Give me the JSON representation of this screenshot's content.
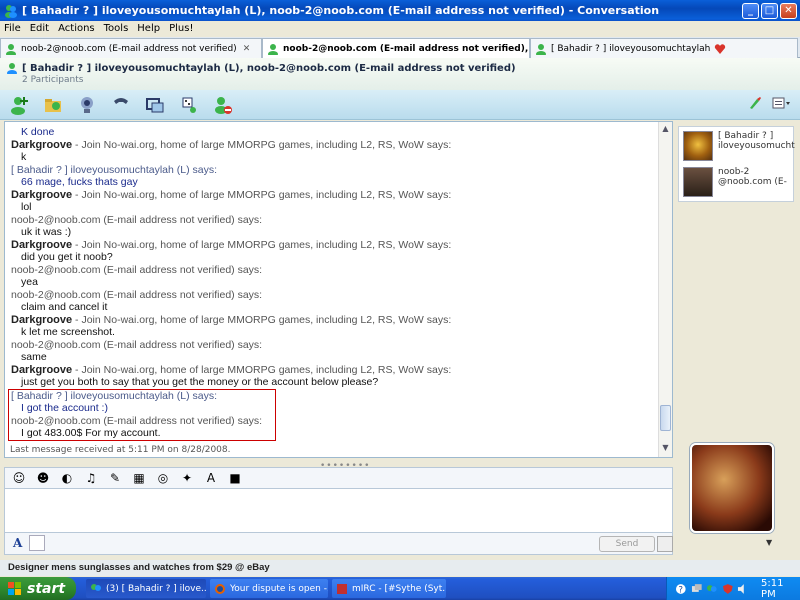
{
  "window": {
    "title": "[ Bahadir ? ] iloveyousomuchtaylah (L), noob-2@noob.com (E-mail address not verified) - Conversation",
    "buttons": [
      "_",
      "□",
      "✕"
    ]
  },
  "menu": [
    "File",
    "Edit",
    "Actions",
    "Tools",
    "Help",
    "Plus!"
  ],
  "tabs": [
    {
      "label": "noob-2@noob.com (E-mail address not verified)",
      "close": "✕",
      "active": false
    },
    {
      "label": "noob-2@noob.com (E-mail address not verified), [ ...",
      "close": "✕",
      "active": true
    },
    {
      "label": "[ Bahadir ? ] iloveyousomuchtaylah",
      "close": "",
      "active": false
    }
  ],
  "header": {
    "participants_line": "[ Bahadir ? ] iloveyousomuchtaylah (L), noob-2@noob.com (E-mail address not verified)",
    "count": "2 Participants"
  },
  "toolbar_icons": [
    "invite-icon",
    "share-files-icon",
    "video-call-icon",
    "phone-icon",
    "activities-icon",
    "games-icon",
    "block-icon"
  ],
  "messages": [
    {
      "sender": "",
      "text": "K done",
      "style": "blue",
      "partial": true
    },
    {
      "sender": "Darkgroove",
      "suffix": " - Join No-wai.org, home of large MMORPG games, including L2, RS, WoW says:",
      "text": "k",
      "style": "dg"
    },
    {
      "sender": "[ Bahadir ? ] iloveyousomuchtaylah (L) says:",
      "text": "66 mage, fucks thats gay",
      "style": "bh"
    },
    {
      "sender": "Darkgroove",
      "suffix": " - Join No-wai.org, home of large MMORPG games, including L2, RS, WoW says:",
      "text": "lol",
      "style": "dg"
    },
    {
      "sender": "noob-2@noob.com (E-mail address not verified) says:",
      "text": "uk it was :)",
      "style": "nb"
    },
    {
      "sender": "Darkgroove",
      "suffix": " - Join No-wai.org, home of large MMORPG games, including L2, RS, WoW says:",
      "text": "did you get it noob?",
      "style": "dg"
    },
    {
      "sender": "noob-2@noob.com (E-mail address not verified) says:",
      "text": "yea",
      "style": "nb"
    },
    {
      "sender": "noob-2@noob.com (E-mail address not verified) says:",
      "text": "claim and cancel it",
      "style": "nb"
    },
    {
      "sender": "Darkgroove",
      "suffix": " - Join No-wai.org, home of large MMORPG games, including L2, RS, WoW says:",
      "text": "k let me screenshot.",
      "style": "dg"
    },
    {
      "sender": "noob-2@noob.com (E-mail address not verified) says:",
      "text": "same",
      "style": "nb"
    },
    {
      "sender": "Darkgroove",
      "suffix": " - Join No-wai.org, home of large MMORPG games, including L2, RS, WoW says:",
      "text": "just get you both to say that you get the money or the account below please?",
      "style": "dg"
    }
  ],
  "highlighted": [
    {
      "sender": "[ Bahadir ? ] iloveyousomuchtaylah (L) says:",
      "text": "I got the account :)",
      "style": "bh"
    },
    {
      "sender": "noob-2@noob.com (E-mail address not verified) says:",
      "text": "I got 483.00$ For my account.",
      "style": "nb"
    }
  ],
  "status": "Last message received at 5:11 PM on 8/28/2008.",
  "splitter": "••••••••",
  "input": {
    "send_label": "Send",
    "format_label": "A"
  },
  "participants": [
    {
      "line1": "[ Bahadir ? ]",
      "line2": "iloveyousomucht"
    },
    {
      "line1": "noob-2",
      "line2": "@noob.com (E-"
    }
  ],
  "ad": "Designer mens sunglasses and watches from $29 @ eBay",
  "taskbar": {
    "start": "start",
    "items": [
      {
        "label": "(3) [ Bahadir ? ] ilove...",
        "active": true
      },
      {
        "label": "Your dispute is open -...",
        "active": false
      },
      {
        "label": "mIRC - [#Sythe (Syt...",
        "active": false
      }
    ],
    "clock": "5:11 PM"
  },
  "colors": {
    "titlebar": "#0a5fd9",
    "highlight_border": "#cc0000",
    "taskbar": "#245edb",
    "start": "#2e8a2e"
  }
}
